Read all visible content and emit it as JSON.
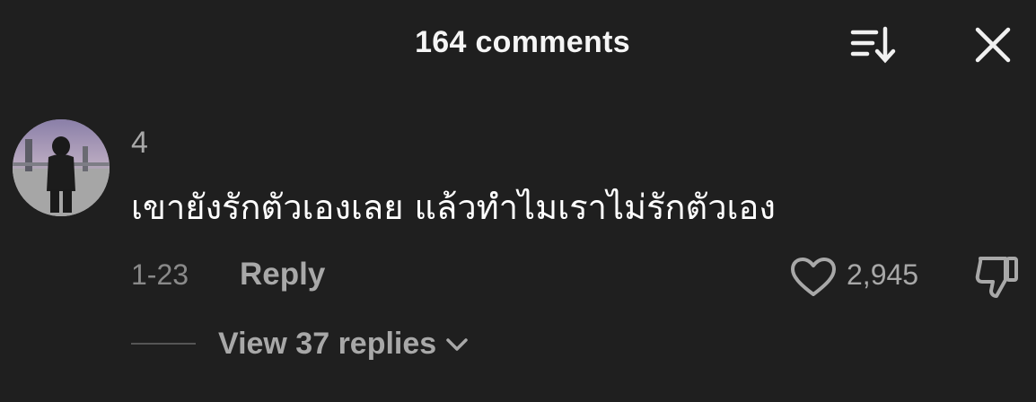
{
  "header": {
    "title": "164 comments",
    "sort_icon": "sort-icon",
    "close_icon": "close-icon"
  },
  "comment": {
    "avatar": "avatar",
    "username": "4",
    "text": "เขายังรักตัวเองเลย แล้วทำไมเราไม่รักตัวเอง",
    "date": "1-23",
    "reply_label": "Reply",
    "like_icon": "heart-icon",
    "like_count": "2,945",
    "dislike_icon": "thumbs-down-icon"
  },
  "replies": {
    "view_label": "View 37 replies",
    "chevron_icon": "chevron-down-icon"
  },
  "colors": {
    "background": "#1f1f1f",
    "primary_text": "#ffffff",
    "secondary_text": "#a8a8a8"
  }
}
